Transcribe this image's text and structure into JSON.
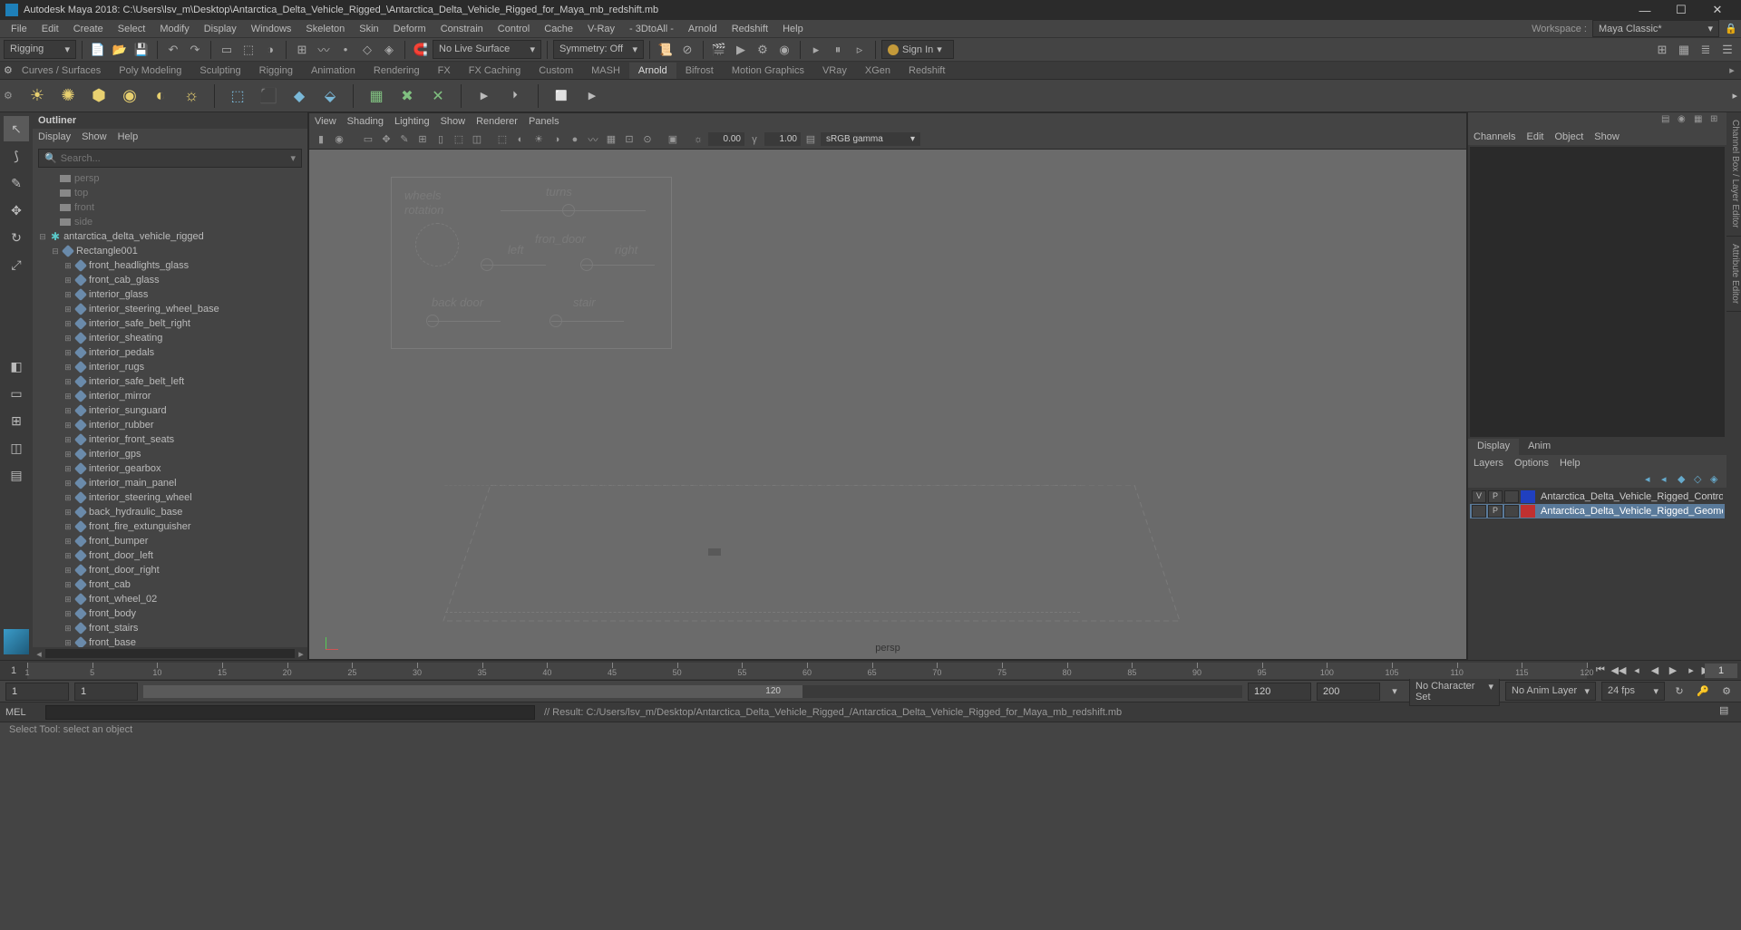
{
  "titlebar": {
    "app": "Autodesk Maya 2018: C:\\Users\\lsv_m\\Desktop\\Antarctica_Delta_Vehicle_Rigged_\\Antarctica_Delta_Vehicle_Rigged_for_Maya_mb_redshift.mb"
  },
  "menubar": {
    "items": [
      "File",
      "Edit",
      "Create",
      "Select",
      "Modify",
      "Display",
      "Windows",
      "Skeleton",
      "Skin",
      "Deform",
      "Constrain",
      "Control",
      "Cache",
      "V-Ray",
      "- 3DtoAll -",
      "Arnold",
      "Redshift",
      "Help"
    ],
    "workspace_label": "Workspace :",
    "workspace": "Maya Classic*"
  },
  "toolbar": {
    "mode": "Rigging",
    "no_live_surface": "No Live Surface",
    "symmetry": "Symmetry: Off",
    "signin": "Sign In"
  },
  "shelftabs": [
    "Curves / Surfaces",
    "Poly Modeling",
    "Sculpting",
    "Rigging",
    "Animation",
    "Rendering",
    "FX",
    "FX Caching",
    "Custom",
    "MASH",
    "Arnold",
    "Bifrost",
    "Motion Graphics",
    "VRay",
    "XGen",
    "Redshift"
  ],
  "shelftabs_active": 10,
  "outliner": {
    "title": "Outliner",
    "menu": [
      "Display",
      "Show",
      "Help"
    ],
    "search_placeholder": "Search...",
    "cameras": [
      "persp",
      "top",
      "front",
      "side"
    ],
    "root": "antarctica_delta_vehicle_rigged",
    "group": "Rectangle001",
    "items": [
      "front_headlights_glass",
      "front_cab_glass",
      "interior_glass",
      "interior_steering_wheel_base",
      "interior_safe_belt_right",
      "interior_sheating",
      "interior_pedals",
      "interior_rugs",
      "interior_safe_belt_left",
      "interior_mirror",
      "interior_sunguard",
      "interior_rubber",
      "interior_front_seats",
      "interior_gps",
      "interior_gearbox",
      "interior_main_panel",
      "interior_steering_wheel",
      "back_hydraulic_base",
      "front_fire_extunguisher",
      "front_bumper",
      "front_door_left",
      "front_door_right",
      "front_cab",
      "front_wheel_02",
      "front_body",
      "front_stairs",
      "front_base"
    ]
  },
  "viewport": {
    "menu": [
      "View",
      "Shading",
      "Lighting",
      "Show",
      "Renderer",
      "Panels"
    ],
    "num_a": "0.00",
    "num_b": "1.00",
    "gamma": "sRGB gamma",
    "persp": "persp",
    "rig_labels": {
      "wheels": "wheels",
      "rotation": "rotation",
      "turns": "turns",
      "front_door": "fron_door",
      "left": "left",
      "right": "right",
      "back_door": "back door",
      "stair": "stair"
    }
  },
  "rightpanel": {
    "top_tabs": [
      "Channels",
      "Edit",
      "Object",
      "Show"
    ],
    "mid_tabs": [
      "Display",
      "Anim"
    ],
    "mid_menu": [
      "Layers",
      "Options",
      "Help"
    ],
    "layers": [
      {
        "v": "V",
        "p": "P",
        "color": "#2040c0",
        "name": "Antarctica_Delta_Vehicle_Rigged_Controllers"
      },
      {
        "v": "",
        "p": "P",
        "color": "#c03030",
        "name": "Antarctica_Delta_Vehicle_Rigged_Geometry"
      }
    ]
  },
  "sidetabs": [
    "Channel Box / Layer Editor",
    "Attribute Editor"
  ],
  "timeslider": {
    "start": "1",
    "end": "1",
    "ticks": [
      1,
      5,
      10,
      15,
      20,
      25,
      30,
      35,
      40,
      45,
      50,
      55,
      60,
      65,
      70,
      75,
      80,
      85,
      90,
      95,
      100,
      105,
      110,
      115,
      120
    ]
  },
  "rangeslider": {
    "start_a": "1",
    "start_b": "1",
    "end_a": "120",
    "end_b": "200",
    "char_set": "No Character Set",
    "anim_layer": "No Anim Layer",
    "fps": "24 fps",
    "range_label": "120"
  },
  "cmdline": {
    "label": "MEL",
    "result": "// Result: C:/Users/lsv_m/Desktop/Antarctica_Delta_Vehicle_Rigged_/Antarctica_Delta_Vehicle_Rigged_for_Maya_mb_redshift.mb"
  },
  "helpline": "Select Tool: select an object"
}
